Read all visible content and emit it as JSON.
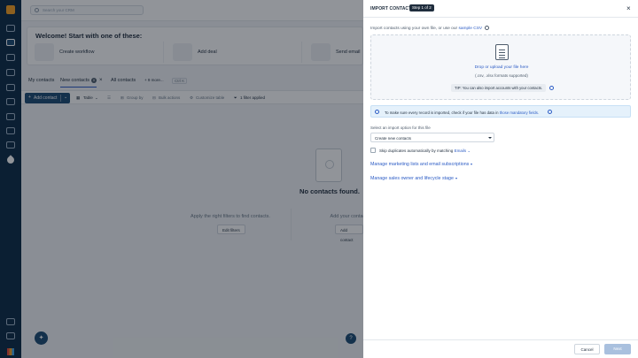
{
  "background": {
    "search_placeholder": "Search your CRM",
    "welcome_title": "Welcome! Start with one of these:",
    "cards": [
      "Create workflow",
      "Add deal",
      "Send email"
    ],
    "tabs": {
      "my_contacts": "My contacts",
      "new_contacts": "New contacts",
      "new_contacts_count": "0",
      "all_contacts": "All contacts",
      "more_views": "+ 9 more...",
      "ctrl_k": "Ctrl K"
    },
    "toolbar": {
      "add_contact": "Add contact",
      "table": "Table",
      "group_by": "Group by",
      "bulk_actions": "Bulk actions",
      "customize_table": "Customize table",
      "filters_applied": "1 filter applied"
    },
    "empty": {
      "title": "No contacts found.",
      "left_text": "Apply the right filters to find contacts.",
      "left_button": "Edit filters",
      "right_text": "Add your contacts to the CRM.",
      "right_button": "Add contact"
    }
  },
  "panel": {
    "title": "IMPORT CONTACTS",
    "step": "Step 1 of 2",
    "intro_prefix": "Import contacts using your own file, or use our",
    "intro_link": "sample CSV",
    "drop_cta": "Drop or upload your file here",
    "drop_formats": "(.csv, .xlsx formats supported)",
    "tip": "TIP: You can also import accounts with your contacts.",
    "notice_prefix": "To make sure every record is imported, check if your file has data in",
    "notice_link": "those mandatory fields.",
    "import_label": "Select an import option for this file",
    "import_value": "Create new contacts",
    "skip_prefix": "Skip duplicates automatically by matching",
    "skip_link": "Emails",
    "section1": "Manage marketing lists and email subscriptions",
    "section2": "Manage sales owner and lifecycle stage",
    "cancel": "Cancel",
    "next": "Next"
  }
}
